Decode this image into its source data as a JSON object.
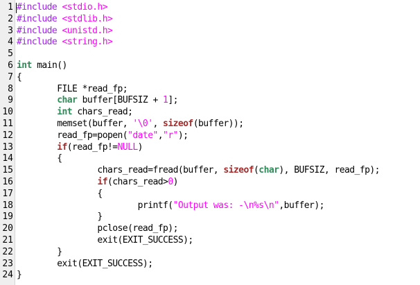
{
  "editor": {
    "line_numbers": [
      "1",
      "2",
      "3",
      "4",
      "5",
      "6",
      "7",
      "8",
      "9",
      "10",
      "11",
      "12",
      "13",
      "14",
      "15",
      "16",
      "17",
      "18",
      "19",
      "20",
      "21",
      "22",
      "23",
      "24"
    ],
    "lines": [
      [
        {
          "c": "pre",
          "t": "#include "
        },
        {
          "c": "inc",
          "t": "<stdio.h>"
        }
      ],
      [
        {
          "c": "pre",
          "t": "#include "
        },
        {
          "c": "inc",
          "t": "<stdlib.h>"
        }
      ],
      [
        {
          "c": "pre",
          "t": "#include "
        },
        {
          "c": "inc",
          "t": "<unistd.h>"
        }
      ],
      [
        {
          "c": "pre",
          "t": "#include "
        },
        {
          "c": "inc",
          "t": "<string.h>"
        }
      ],
      [],
      [
        {
          "c": "kw",
          "t": "int"
        },
        {
          "c": "norm",
          "t": " main()"
        }
      ],
      [
        {
          "c": "norm",
          "t": "{"
        }
      ],
      [
        {
          "c": "norm",
          "t": "        FILE *read_fp;"
        }
      ],
      [
        {
          "c": "norm",
          "t": "        "
        },
        {
          "c": "kw",
          "t": "char"
        },
        {
          "c": "norm",
          "t": " buffer[BUFSIZ + "
        },
        {
          "c": "num",
          "t": "1"
        },
        {
          "c": "norm",
          "t": "];"
        }
      ],
      [
        {
          "c": "norm",
          "t": "        "
        },
        {
          "c": "kw",
          "t": "int"
        },
        {
          "c": "norm",
          "t": " chars_read;"
        }
      ],
      [
        {
          "c": "norm",
          "t": "        memset(buffer, "
        },
        {
          "c": "str",
          "t": "'\\0'"
        },
        {
          "c": "norm",
          "t": ", "
        },
        {
          "c": "kw2",
          "t": "sizeof"
        },
        {
          "c": "norm",
          "t": "(buffer));"
        }
      ],
      [
        {
          "c": "norm",
          "t": "        read_fp=popen("
        },
        {
          "c": "str",
          "t": "\"date\""
        },
        {
          "c": "norm",
          "t": ","
        },
        {
          "c": "str",
          "t": "\"r\""
        },
        {
          "c": "norm",
          "t": ");"
        }
      ],
      [
        {
          "c": "norm",
          "t": "        "
        },
        {
          "c": "kw2",
          "t": "if"
        },
        {
          "c": "norm",
          "t": "(read_fp!="
        },
        {
          "c": "str",
          "t": "NULL"
        },
        {
          "c": "norm",
          "t": ")"
        }
      ],
      [
        {
          "c": "norm",
          "t": "        {"
        }
      ],
      [
        {
          "c": "norm",
          "t": "                chars_read=fread(buffer, "
        },
        {
          "c": "kw2",
          "t": "sizeof"
        },
        {
          "c": "norm",
          "t": "("
        },
        {
          "c": "kw",
          "t": "char"
        },
        {
          "c": "norm",
          "t": "), BUFSIZ, read_fp);"
        }
      ],
      [
        {
          "c": "norm",
          "t": "                "
        },
        {
          "c": "kw2",
          "t": "if"
        },
        {
          "c": "norm",
          "t": "(chars_read>"
        },
        {
          "c": "num",
          "t": "0"
        },
        {
          "c": "norm",
          "t": ")"
        }
      ],
      [
        {
          "c": "norm",
          "t": "                {"
        }
      ],
      [
        {
          "c": "norm",
          "t": "                        printf("
        },
        {
          "c": "str",
          "t": "\"Output was: -\\n%s\\n\""
        },
        {
          "c": "norm",
          "t": ",buffer);"
        }
      ],
      [
        {
          "c": "norm",
          "t": "                }"
        }
      ],
      [
        {
          "c": "norm",
          "t": "                pclose(read_fp);"
        }
      ],
      [
        {
          "c": "norm",
          "t": "                exit(EXIT_SUCCESS);"
        }
      ],
      [
        {
          "c": "norm",
          "t": "        }"
        }
      ],
      [
        {
          "c": "norm",
          "t": "        exit(EXIT_SUCCESS);"
        }
      ],
      [
        {
          "c": "norm",
          "t": "}"
        }
      ]
    ]
  }
}
